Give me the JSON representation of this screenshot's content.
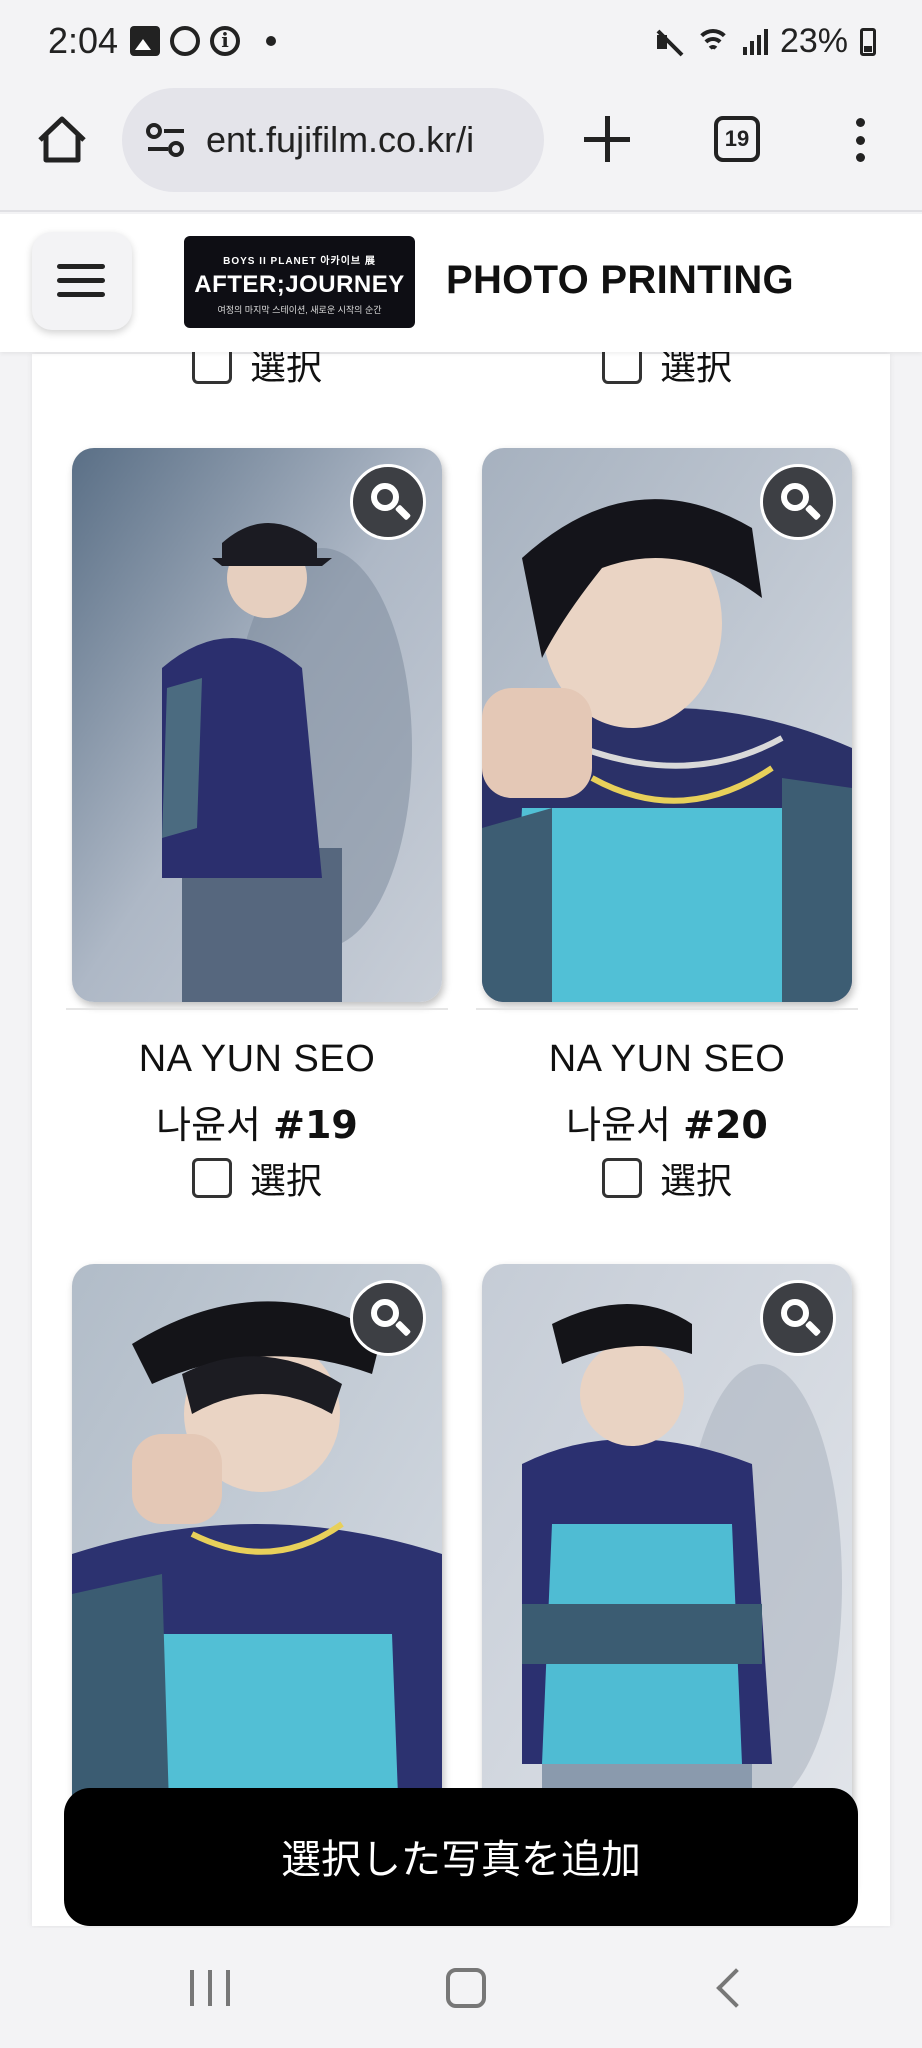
{
  "status_bar": {
    "time": "2:04",
    "battery": "23%"
  },
  "browser": {
    "url": "ent.fujifilm.co.kr/i",
    "tab_count": "19"
  },
  "header": {
    "logo_top": "BOYS II PLANET 아카이브 展",
    "logo_main": "AFTER;JOURNEY",
    "logo_sub": "여정의 마지막 스테이션, 새로운 시작의 순간",
    "title": "PHOTO PRINTING"
  },
  "select_label": "選択",
  "cards": [
    {
      "name": "NA YUN SEO",
      "korean": "나윤서",
      "number": "#19"
    },
    {
      "name": "NA YUN SEO",
      "korean": "나윤서",
      "number": "#20"
    }
  ],
  "add_button_label": "選択した写真を追加",
  "colors": {
    "page_bg": "#f3f3f5",
    "button_bg": "#000000",
    "header_bg": "#ffffff"
  }
}
